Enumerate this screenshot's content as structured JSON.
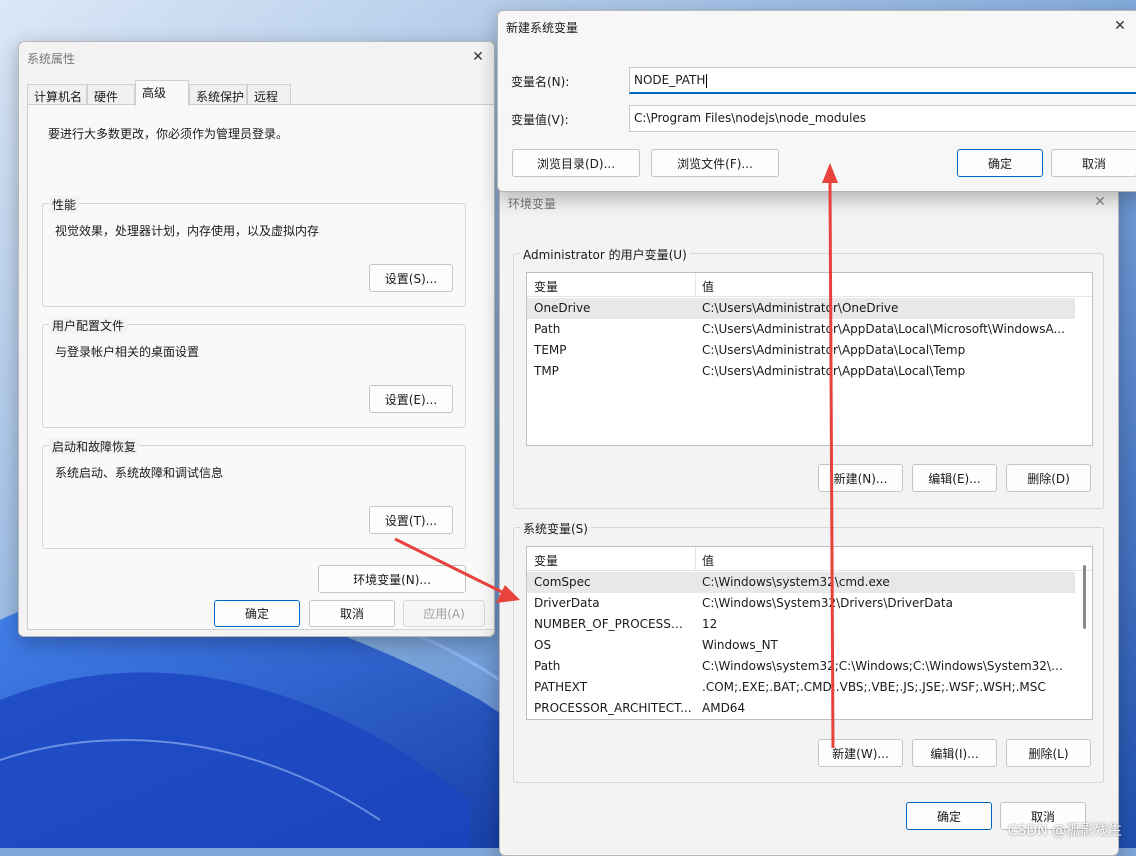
{
  "sysprops": {
    "title": "系统属性",
    "tabs": [
      "计算机名",
      "硬件",
      "高级",
      "系统保护",
      "远程"
    ],
    "admin_note": "要进行大多数更改，你必须作为管理员登录。",
    "performance": {
      "label": "性能",
      "desc": "视觉效果，处理器计划，内存使用，以及虚拟内存",
      "button": "设置(S)..."
    },
    "profile": {
      "label": "用户配置文件",
      "desc": "与登录帐户相关的桌面设置",
      "button": "设置(E)..."
    },
    "startup": {
      "label": "启动和故障恢复",
      "desc": "系统启动、系统故障和调试信息",
      "button": "设置(T)..."
    },
    "env_button": "环境变量(N)...",
    "ok": "确定",
    "cancel": "取消",
    "apply": "应用(A)"
  },
  "envvars": {
    "title": "环境变量",
    "user_group_label": "Administrator 的用户变量(U)",
    "col_var": "变量",
    "col_val": "值",
    "user_vars": [
      {
        "name": "OneDrive",
        "value": "C:\\Users\\Administrator\\OneDrive"
      },
      {
        "name": "Path",
        "value": "C:\\Users\\Administrator\\AppData\\Local\\Microsoft\\WindowsA..."
      },
      {
        "name": "TEMP",
        "value": "C:\\Users\\Administrator\\AppData\\Local\\Temp"
      },
      {
        "name": "TMP",
        "value": "C:\\Users\\Administrator\\AppData\\Local\\Temp"
      }
    ],
    "user_buttons": {
      "new": "新建(N)...",
      "edit": "编辑(E)...",
      "delete": "删除(D)"
    },
    "sys_group_label": "系统变量(S)",
    "sys_vars": [
      {
        "name": "ComSpec",
        "value": "C:\\Windows\\system32\\cmd.exe"
      },
      {
        "name": "DriverData",
        "value": "C:\\Windows\\System32\\Drivers\\DriverData"
      },
      {
        "name": "NUMBER_OF_PROCESSORS",
        "value": "12"
      },
      {
        "name": "OS",
        "value": "Windows_NT"
      },
      {
        "name": "Path",
        "value": "C:\\Windows\\system32;C:\\Windows;C:\\Windows\\System32\\Wb..."
      },
      {
        "name": "PATHEXT",
        "value": ".COM;.EXE;.BAT;.CMD;.VBS;.VBE;.JS;.JSE;.WSF;.WSH;.MSC"
      },
      {
        "name": "PROCESSOR_ARCHITECT...",
        "value": "AMD64"
      }
    ],
    "sys_buttons": {
      "new": "新建(W)...",
      "edit": "编辑(I)...",
      "delete": "删除(L)"
    },
    "ok": "确定",
    "cancel": "取消"
  },
  "newvar": {
    "title": "新建系统变量",
    "name_label": "变量名(N):",
    "name_value": "NODE_PATH",
    "value_label": "变量值(V):",
    "value_value": "C:\\Program Files\\nodejs\\node_modules",
    "browse_dir": "浏览目录(D)...",
    "browse_file": "浏览文件(F)...",
    "ok": "确定",
    "cancel": "取消"
  },
  "watermark": "CSDN @孤影残生",
  "annotation_color": "#e8423c",
  "accent_color": "#0067c0"
}
